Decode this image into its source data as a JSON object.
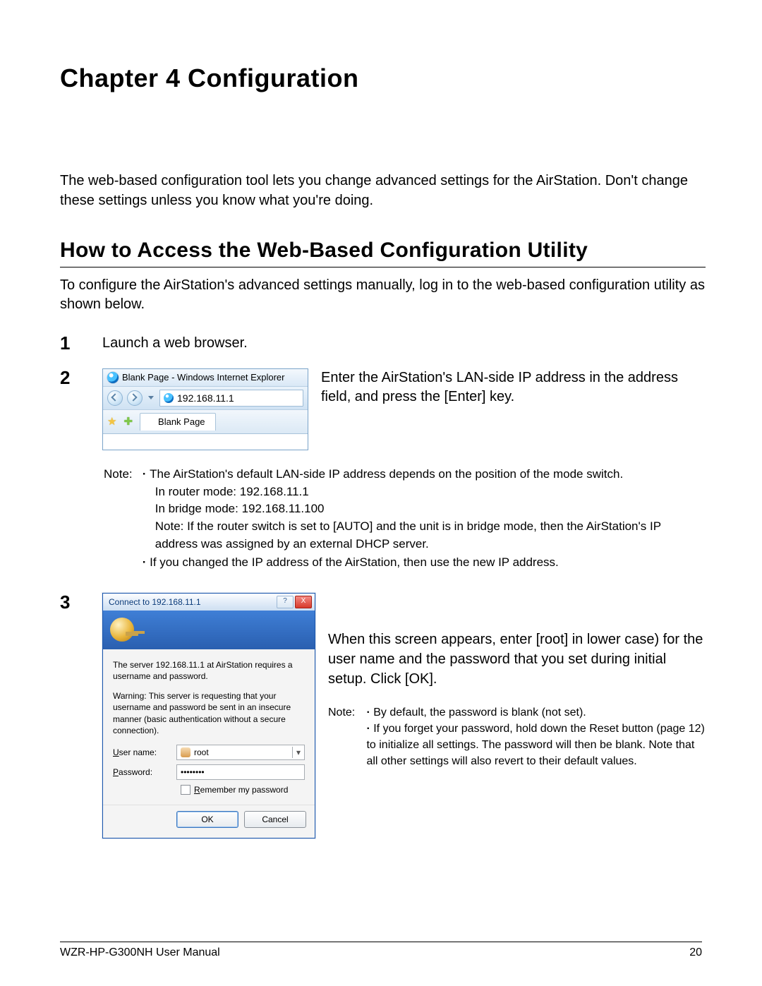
{
  "chapter_title": "Chapter 4 Configuration",
  "intro": "The web-based configuration tool lets you change advanced settings for the AirStation. Don't change these settings unless you know what you're doing.",
  "section_title": "How to Access the Web-Based Configuration Utility",
  "section_intro": "To configure the AirStation's advanced  settings manually, log in to the web-based configuration utility as shown below.",
  "steps": {
    "s1_num": "1",
    "s1_text": "Launch a web browser.",
    "s2_num": "2",
    "s2_text": "Enter the AirStation's LAN-side IP address in the address field, and press the [Enter] key.",
    "s3_num": "3",
    "s3_text": "When this screen appears, enter [root] in lower case) for the user name and the password that you set during initial setup. Click [OK]."
  },
  "browser_shot": {
    "title": "Blank Page - Windows Internet Explorer",
    "url": "192.168.11.1",
    "tab": "Blank Page"
  },
  "note1": {
    "label": "Note:",
    "b1": "The AirStation's default LAN-side IP address depends on the position of the mode switch.",
    "b1a": "In router mode:  192.168.11.1",
    "b1b": "In bridge mode:  192.168.11.100",
    "b1c": "Note:   If the router switch is set to [AUTO] and the unit is in bridge mode, then the AirStation's IP address was assigned by an external DHCP server.",
    "b2": "If you changed the IP address of the AirStation, then use the new IP address."
  },
  "dialog": {
    "title": "Connect to 192.168.11.1",
    "help": "?",
    "close": "X",
    "msg1": "The server 192.168.11.1 at AirStation requires a username and password.",
    "msg2": "Warning: This server is requesting that your username and password be sent in an insecure manner (basic authentication without a secure connection).",
    "user_label_u": "U",
    "user_label_rest": "ser name:",
    "user_value": "root",
    "pass_label_u": "P",
    "pass_label_rest": "assword:",
    "pass_value": "••••••••",
    "remember_u": "R",
    "remember_rest": "emember my password",
    "ok": "OK",
    "cancel": "Cancel"
  },
  "note2": {
    "label": "Note:",
    "b1": "By default, the password is blank (not set).",
    "b2": "If you forget your password, hold down the  Reset button (page 12) to initialize all settings. The password will then be blank. Note that all other settings will also revert to their default values."
  },
  "footer": {
    "left": "WZR-HP-G300NH User Manual",
    "right": "20"
  }
}
